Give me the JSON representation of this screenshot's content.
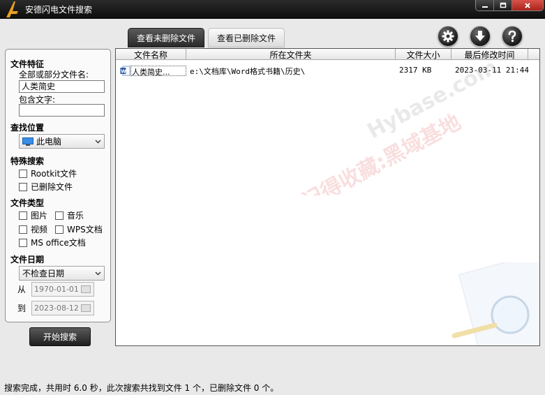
{
  "window": {
    "title": "安德闪电文件搜索"
  },
  "tabs": {
    "active": "查看未删除文件",
    "inactive": "查看已删除文件"
  },
  "toolbar": {
    "icons": [
      "gear-icon",
      "download-icon",
      "help-icon"
    ]
  },
  "sidebar": {
    "features_title": "文件特征",
    "filename_label": "全部或部分文件名:",
    "filename_value": "人类简史",
    "contains_label": "包含文字:",
    "contains_value": "",
    "location_title": "查找位置",
    "location_value": "此电脑",
    "special_title": "特殊搜索",
    "special_options": [
      "Rootkit文件",
      "已删除文件"
    ],
    "types_title": "文件类型",
    "types_options": [
      "图片",
      "音乐",
      "视频",
      "WPS文档",
      "MS office文档"
    ],
    "date_title": "文件日期",
    "date_mode": "不检查日期",
    "from_label": "从",
    "from_value": "1970-01-01",
    "to_label": "到",
    "to_value": "2023-08-12"
  },
  "search_button": "开始搜索",
  "table": {
    "columns": [
      "文件名称",
      "所在文件夹",
      "文件大小",
      "最后修改时间"
    ],
    "rows": [
      {
        "name": "人类简史...",
        "folder": "e:\\文档库\\Word格式书籍\\历史\\",
        "size": "2317 KB",
        "modified": "2023-03-11 21:44"
      }
    ]
  },
  "watermark": {
    "line1": "记得收藏:黑域基地",
    "line2": "Hybase.com"
  },
  "status": "搜索完成，共用时 6.0 秒，此次搜索共找到文件 1 个，已删除文件 0 个。",
  "colors": {
    "titlebar": "#1a1a1a",
    "active_tab": "#3a3a3a",
    "watermark": "#e05050",
    "app_logo": "#e8a020"
  }
}
